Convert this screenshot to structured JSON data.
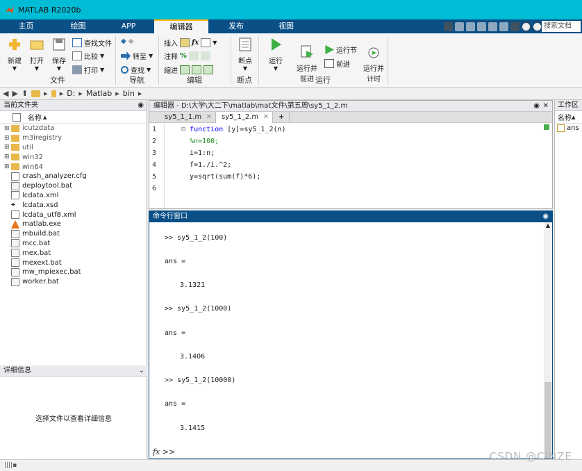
{
  "window": {
    "title": "MATLAB R2020b"
  },
  "tabs": [
    "主页",
    "绘图",
    "APP",
    "编辑器",
    "发布",
    "视图"
  ],
  "active_tab": "编辑器",
  "search_placeholder": "搜索文档",
  "ribbon": {
    "new": "新建",
    "open": "打开",
    "save": "保存",
    "find_files": "查找文件",
    "compare": "比较",
    "print": "打印",
    "file_group": "文件",
    "goto": "转至",
    "find": "查找",
    "navigate_group": "导航",
    "insert": "插入",
    "fx": "fx",
    "comment": "注释",
    "comment_pct": "%",
    "indent": "缩进",
    "edit_group": "编辑",
    "breakpoints": "断点",
    "breakpoints_group": "断点",
    "run": "运行",
    "run_advance": "运行并\n前进",
    "run_section": "运行节",
    "advance": "前进",
    "run_time": "运行并\n计时",
    "run_group": "运行"
  },
  "address": [
    "D:",
    "Matlab",
    "bin"
  ],
  "current_folder": {
    "title": "当前文件夹",
    "column": "名称",
    "items": [
      {
        "name": "icutzdata",
        "type": "folder"
      },
      {
        "name": "m3iregistry",
        "type": "folder"
      },
      {
        "name": "util",
        "type": "folder"
      },
      {
        "name": "win32",
        "type": "folder"
      },
      {
        "name": "win64",
        "type": "folder"
      },
      {
        "name": "crash_analyzer.cfg",
        "type": "doc"
      },
      {
        "name": "deploytool.bat",
        "type": "bat"
      },
      {
        "name": "lcdata.xml",
        "type": "xml"
      },
      {
        "name": "lcdata.xsd",
        "type": "xsd"
      },
      {
        "name": "lcdata_utf8.xml",
        "type": "xml"
      },
      {
        "name": "matlab.exe",
        "type": "exe"
      },
      {
        "name": "mbuild.bat",
        "type": "bat"
      },
      {
        "name": "mcc.bat",
        "type": "bat"
      },
      {
        "name": "mex.bat",
        "type": "bat"
      },
      {
        "name": "mexext.bat",
        "type": "bat"
      },
      {
        "name": "mw_mpiexec.bat",
        "type": "bat"
      },
      {
        "name": "worker.bat",
        "type": "bat"
      }
    ]
  },
  "details": {
    "title": "详细信息",
    "message": "选择文件以查看详细信息"
  },
  "editor": {
    "title": "编辑器 - D:\\大学\\大二下\\matlab\\mat文件\\第五周\\sy5_1_2.m",
    "tabs": [
      "sy5_1_1.m",
      "sy5_1_2.m"
    ],
    "active_tab": "sy5_1_2.m",
    "lines": [
      {
        "n": "1",
        "kw": "function",
        "rest": " [y]=sy5_1_2(n)",
        "cm": ""
      },
      {
        "n": "2",
        "kw": "",
        "rest": "",
        "cm": "%n=100;"
      },
      {
        "n": "3",
        "kw": "",
        "rest": "i=1:n;",
        "cm": ""
      },
      {
        "n": "4",
        "kw": "",
        "rest": "f=1./i.^2;",
        "cm": ""
      },
      {
        "n": "5",
        "kw": "",
        "rest": "y=sqrt(sum(f)*6);",
        "cm": ""
      },
      {
        "n": "6",
        "kw": "",
        "rest": "",
        "cm": ""
      }
    ]
  },
  "command_window": {
    "title": "命令行窗口",
    "lines": [
      ">> sy5_1_2(100)",
      "ans =",
      "3.1321",
      ">> sy5_1_2(1000)",
      "ans =",
      "3.1406",
      ">> sy5_1_2(10000)",
      "ans =",
      "3.1415"
    ],
    "prompt": "fx >>"
  },
  "workspace": {
    "title": "工作区",
    "column": "名称",
    "vars": [
      "ans"
    ]
  },
  "watermark": "CSDN @CINZE"
}
